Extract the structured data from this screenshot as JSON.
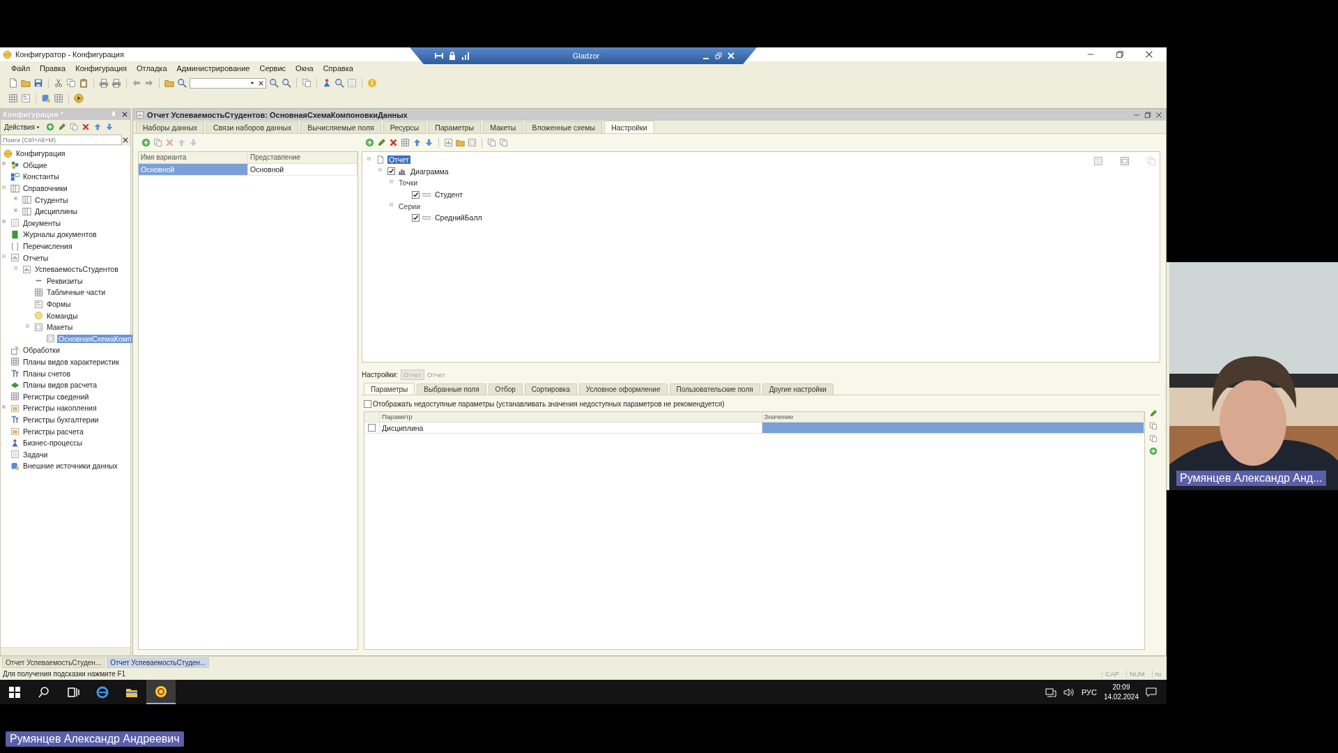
{
  "window": {
    "title": "Конфигуратор - Конфигурация"
  },
  "remote_bar": {
    "title": "Gladzor"
  },
  "menu": [
    "Файл",
    "Правка",
    "Конфигурация",
    "Отладка",
    "Администрирование",
    "Сервис",
    "Окна",
    "Справка"
  ],
  "config_panel": {
    "title": "Конфигурация *",
    "actions_label": "Действия",
    "search": {
      "placeholder": "Поиск (Ctrl+Alt+M)"
    },
    "tree": [
      {
        "label": "Конфигурация",
        "selected": false,
        "children": [
          {
            "label": "Общие",
            "selected": false,
            "expanded": false
          },
          {
            "label": "Константы",
            "selected": false
          },
          {
            "label": "Справочники",
            "selected": false,
            "expanded": true,
            "children": [
              {
                "label": "Студенты",
                "selected": false,
                "expanded": false
              },
              {
                "label": "Дисциплины",
                "selected": false,
                "expanded": false
              }
            ]
          },
          {
            "label": "Документы",
            "selected": false,
            "expanded": false
          },
          {
            "label": "Журналы документов",
            "selected": false
          },
          {
            "label": "Перечисления",
            "selected": false
          },
          {
            "label": "Отчеты",
            "selected": false,
            "expanded": true,
            "children": [
              {
                "label": "УспеваемостьСтудентов",
                "selected": false,
                "expanded": true,
                "children": [
                  {
                    "label": "Реквизиты",
                    "selected": false
                  },
                  {
                    "label": "Табличные части",
                    "selected": false
                  },
                  {
                    "label": "Формы",
                    "selected": false
                  },
                  {
                    "label": "Команды",
                    "selected": false
                  },
                  {
                    "label": "Макеты",
                    "selected": false,
                    "expanded": true,
                    "children": [
                      {
                        "label": "ОсновнаяСхемаКомп",
                        "selected": true
                      }
                    ]
                  }
                ]
              }
            ]
          },
          {
            "label": "Обработки",
            "selected": false
          },
          {
            "label": "Планы видов характеристик",
            "selected": false
          },
          {
            "label": "Планы счетов",
            "selected": false
          },
          {
            "label": "Планы видов расчета",
            "selected": false
          },
          {
            "label": "Регистры сведений",
            "selected": false
          },
          {
            "label": "Регистры накопления",
            "selected": false,
            "expanded": false
          },
          {
            "label": "Регистры бухгалтерии",
            "selected": false
          },
          {
            "label": "Регистры расчета",
            "selected": false
          },
          {
            "label": "Бизнес-процессы",
            "selected": false
          },
          {
            "label": "Задачи",
            "selected": false
          },
          {
            "label": "Внешние источники данных",
            "selected": false
          }
        ]
      }
    ]
  },
  "document": {
    "title": "Отчет УспеваемостьСтудентов: ОсновнаяСхемаКомпоновкиДанных",
    "tabs": [
      {
        "label": "Наборы данных",
        "selected": false
      },
      {
        "label": "Связи наборов данных",
        "selected": false
      },
      {
        "label": "Вычисляемые поля",
        "selected": false
      },
      {
        "label": "Ресурсы",
        "selected": false
      },
      {
        "label": "Параметры",
        "selected": false
      },
      {
        "label": "Макеты",
        "selected": false
      },
      {
        "label": "Вложенные схемы",
        "selected": false
      },
      {
        "label": "Настройки",
        "selected": true
      }
    ],
    "variants": {
      "columns": [
        "Имя варианта",
        "Представление"
      ],
      "rows": [
        {
          "cells": [
            "Основной",
            "Основной"
          ],
          "selected": true
        }
      ]
    },
    "structure": [
      {
        "kind": "root",
        "label": "Отчет",
        "selected": true,
        "expanded": true,
        "children": [
          {
            "kind": "chart",
            "label": "Диаграмма",
            "checked": true,
            "selected": false,
            "expanded": true,
            "children": [
              {
                "kind": "group",
                "label": "Точки",
                "selected": false,
                "expanded": true,
                "children": [
                  {
                    "kind": "field",
                    "label": "Студент",
                    "checked": true,
                    "selected": false
                  }
                ]
              },
              {
                "kind": "group",
                "label": "Серии",
                "selected": false,
                "expanded": true,
                "children": [
                  {
                    "kind": "field",
                    "label": "СреднийБалл",
                    "checked": true,
                    "selected": false
                  }
                ]
              }
            ]
          }
        ]
      }
    ],
    "settings": {
      "label": "Настройки:",
      "button": "Отчет",
      "current": "Отчет",
      "tabs": [
        {
          "label": "Параметры",
          "selected": true
        },
        {
          "label": "Выбранные поля",
          "selected": false
        },
        {
          "label": "Отбор",
          "selected": false
        },
        {
          "label": "Сортировка",
          "selected": false
        },
        {
          "label": "Условное оформление",
          "selected": false
        },
        {
          "label": "Пользовательские поля",
          "selected": false
        },
        {
          "label": "Другие настройки",
          "selected": false
        }
      ],
      "show_unavailable": {
        "label": "Отображать недоступные параметры (устанавливать значения недоступных параметров не рекомендуется)",
        "checked": false
      },
      "parameters": {
        "columns": [
          "Параметр",
          "Значение"
        ],
        "rows": [
          {
            "name": "Дисциплина",
            "checked": false,
            "selected": true
          }
        ]
      }
    }
  },
  "window_tabs": [
    {
      "label": "Отчет УспеваемостьСтуден...",
      "selected": false
    },
    {
      "label": "Отчет УспеваемостьСтуден...",
      "selected": true
    }
  ],
  "status_bar": {
    "hint": "Для получения подсказки нажмите F1",
    "indicators": [
      "CAP",
      "NUM",
      "ru"
    ]
  },
  "taskbar": {
    "language": "РУС",
    "time": "20:09",
    "date": "14.02.2024"
  },
  "video": {
    "kind": "picture",
    "caption": "Румянцев Александр Анд..."
  },
  "participant_label": "Румянцев Александр Андреевич"
}
